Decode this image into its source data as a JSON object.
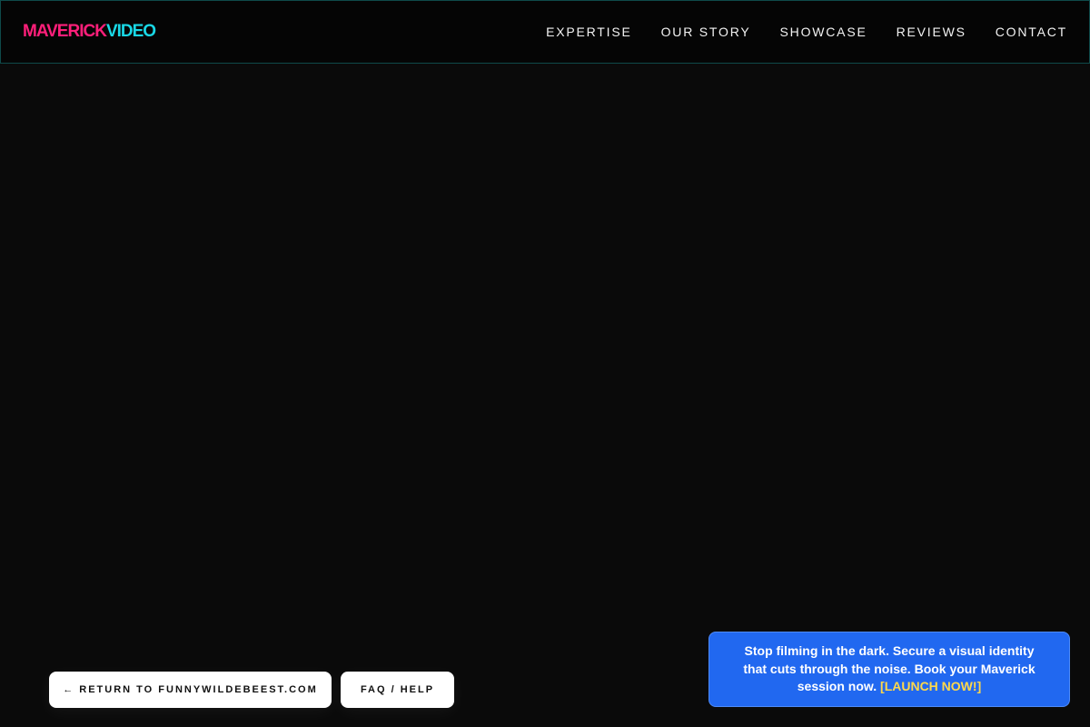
{
  "header": {
    "logo_part1": "MAVERICK",
    "logo_part2": "VIDEO",
    "nav": [
      {
        "label": "EXPERTISE"
      },
      {
        "label": "OUR STORY"
      },
      {
        "label": "SHOWCASE"
      },
      {
        "label": "REVIEWS"
      },
      {
        "label": "CONTACT"
      }
    ]
  },
  "buttons": {
    "return_label": "← RETURN TO FUNNYWILDEBEEST.COM",
    "faq_label": "FAQ / HELP"
  },
  "promo": {
    "text": "Stop filming in the dark. Secure a visual identity that cuts through the noise. Book your Maverick session now.",
    "link_label": "[LAUNCH NOW!]"
  },
  "colors": {
    "brand_pink": "#ff1f7a",
    "brand_cyan": "#19d8e6",
    "promo_blue": "#2168f0",
    "promo_link_yellow": "#ffd84a",
    "background": "#0a0a0a"
  }
}
